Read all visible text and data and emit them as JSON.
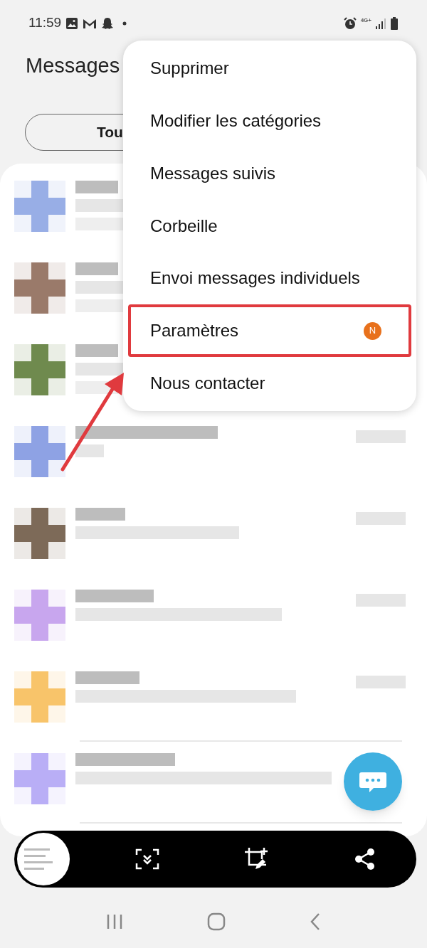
{
  "status_bar": {
    "time": "11:59",
    "network": "4G+"
  },
  "header": {
    "title": "Messages"
  },
  "filter_tab": {
    "label": "Tou"
  },
  "conversations": [
    {
      "color": "#98aee6"
    },
    {
      "color": "#9a7a6a"
    },
    {
      "color": "#6f8a4e"
    },
    {
      "color": "#8ea2e4"
    },
    {
      "color": "#7d6a58"
    },
    {
      "color": "#c8a6ee"
    },
    {
      "color": "#f8c46a"
    },
    {
      "color": "#b9aef6"
    }
  ],
  "menu": {
    "items": [
      {
        "label": "Supprimer",
        "highlighted": false
      },
      {
        "label": "Modifier les catégories",
        "highlighted": false
      },
      {
        "label": "Messages suivis",
        "highlighted": false
      },
      {
        "label": "Corbeille",
        "highlighted": false
      },
      {
        "label": "Envoi messages individuels",
        "highlighted": false
      },
      {
        "label": "Paramètres",
        "highlighted": true,
        "badge": "N"
      },
      {
        "label": "Nous contacter",
        "highlighted": false
      }
    ]
  }
}
